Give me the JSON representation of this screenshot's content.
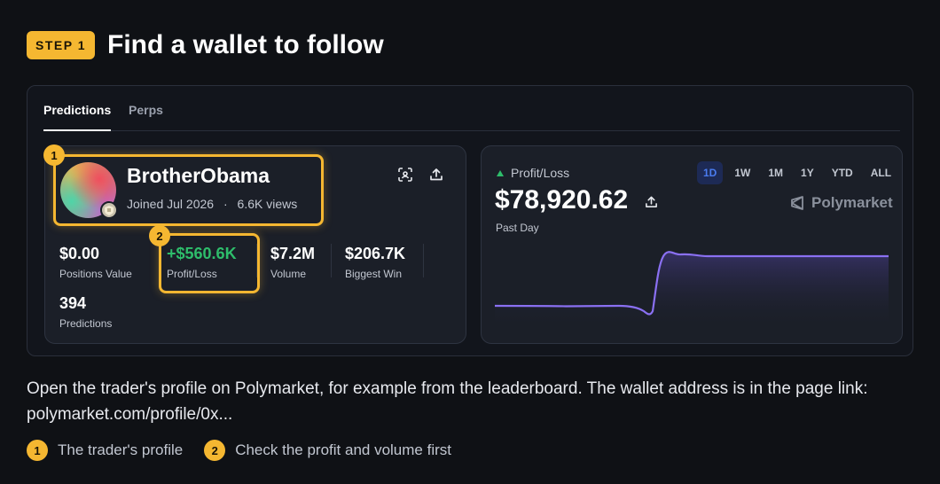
{
  "header": {
    "step": "STEP 1",
    "title": "Find a wallet to follow"
  },
  "tabs": [
    "Predictions",
    "Perps"
  ],
  "profile": {
    "badge": "1",
    "username": "BrotherObama",
    "joined": "Joined Jul 2026",
    "separator": "·",
    "views": "6.6K views",
    "stats": [
      {
        "value": "$0.00",
        "label": "Positions Value"
      },
      {
        "value": "+$560.6K",
        "label": "Profit/Loss"
      },
      {
        "value": "$7.2M",
        "label": "Volume"
      },
      {
        "value": "$206.7K",
        "label": "Biggest Win"
      },
      {
        "value": "394",
        "label": "Predictions"
      }
    ],
    "pnl_badge": "2"
  },
  "pnl": {
    "title": "Profit/Loss",
    "amount": "$78,920.62",
    "period": "Past Day",
    "ranges": [
      "1D",
      "1W",
      "1M",
      "1Y",
      "YTD",
      "ALL"
    ],
    "active_range": "1D",
    "brand": "Polymarket",
    "line_color": "#8a70f2",
    "up_color": "#2ebd6b"
  },
  "description": "Open the trader's profile on Polymarket, for example from the leaderboard. The wallet address is in the page link: polymarket.com/profile/0x...",
  "legend": [
    {
      "num": "1",
      "text": "The trader's profile"
    },
    {
      "num": "2",
      "text": "Check the profit and volume first"
    }
  ],
  "colors": {
    "accent": "#f5b731",
    "positive": "#2ebd6b",
    "selected_range": "#4a7cf0"
  }
}
